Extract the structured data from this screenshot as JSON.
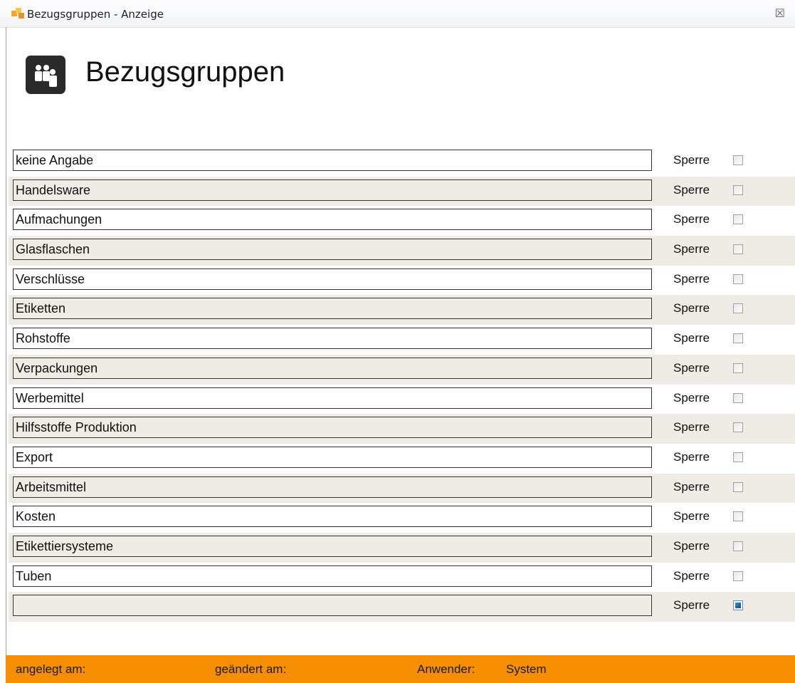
{
  "window": {
    "title": "Bezugsgruppen - Anzeige",
    "close_glyph": "☒"
  },
  "header": {
    "title": "Bezugsgruppen",
    "icon": "users-group-icon"
  },
  "rows": [
    {
      "name": "keine Angabe",
      "lock_label": "Sperre",
      "locked": false
    },
    {
      "name": "Handelsware",
      "lock_label": "Sperre",
      "locked": false
    },
    {
      "name": "Aufmachungen",
      "lock_label": "Sperre",
      "locked": false
    },
    {
      "name": "Glasflaschen",
      "lock_label": "Sperre",
      "locked": false
    },
    {
      "name": "Verschlüsse",
      "lock_label": "Sperre",
      "locked": false
    },
    {
      "name": "Etiketten",
      "lock_label": "Sperre",
      "locked": false
    },
    {
      "name": "Rohstoffe",
      "lock_label": "Sperre",
      "locked": false
    },
    {
      "name": "Verpackungen",
      "lock_label": "Sperre",
      "locked": false
    },
    {
      "name": "Werbemittel",
      "lock_label": "Sperre",
      "locked": false
    },
    {
      "name": "Hilfsstoffe Produktion",
      "lock_label": "Sperre",
      "locked": false
    },
    {
      "name": "Export",
      "lock_label": "Sperre",
      "locked": false
    },
    {
      "name": "Arbeitsmittel",
      "lock_label": "Sperre",
      "locked": false
    },
    {
      "name": "Kosten",
      "lock_label": "Sperre",
      "locked": false
    },
    {
      "name": "Etikettiersysteme",
      "lock_label": "Sperre",
      "locked": false
    },
    {
      "name": "Tuben",
      "lock_label": "Sperre",
      "locked": false
    },
    {
      "name": "",
      "lock_label": "Sperre",
      "locked": true
    }
  ],
  "footer": {
    "created_label": "angelegt am:",
    "changed_label": "geändert am:",
    "user_label": "Anwender:",
    "user_value": "System"
  },
  "colors": {
    "footer_bg": "#f58f00",
    "alt_row_bg": "#eeece4"
  }
}
